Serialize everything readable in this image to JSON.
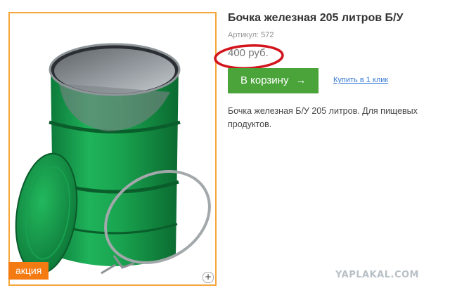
{
  "product": {
    "title": "Бочка железная 205 литров Б/У",
    "sku_label": "Артикул:",
    "sku_value": "572",
    "price": "400 руб.",
    "description": "Бочка железная Б/У 205 литров. Для пищевых продуктов."
  },
  "actions": {
    "add_to_cart_label": "В корзину",
    "add_to_cart_icon": "arrow-right-icon",
    "one_click_label": "Купить в 1 клик"
  },
  "gallery": {
    "badge": "акция",
    "zoom_icon": "plus-icon",
    "zoom_symbol": "+"
  },
  "watermark": "YAPLAKAL.COM",
  "colors": {
    "accent_green": "#4ba43a",
    "badge_orange": "#f47a12",
    "frame_orange": "#f5a53a",
    "annotation_red": "#d2141c",
    "link_blue": "#3a7bd5"
  }
}
